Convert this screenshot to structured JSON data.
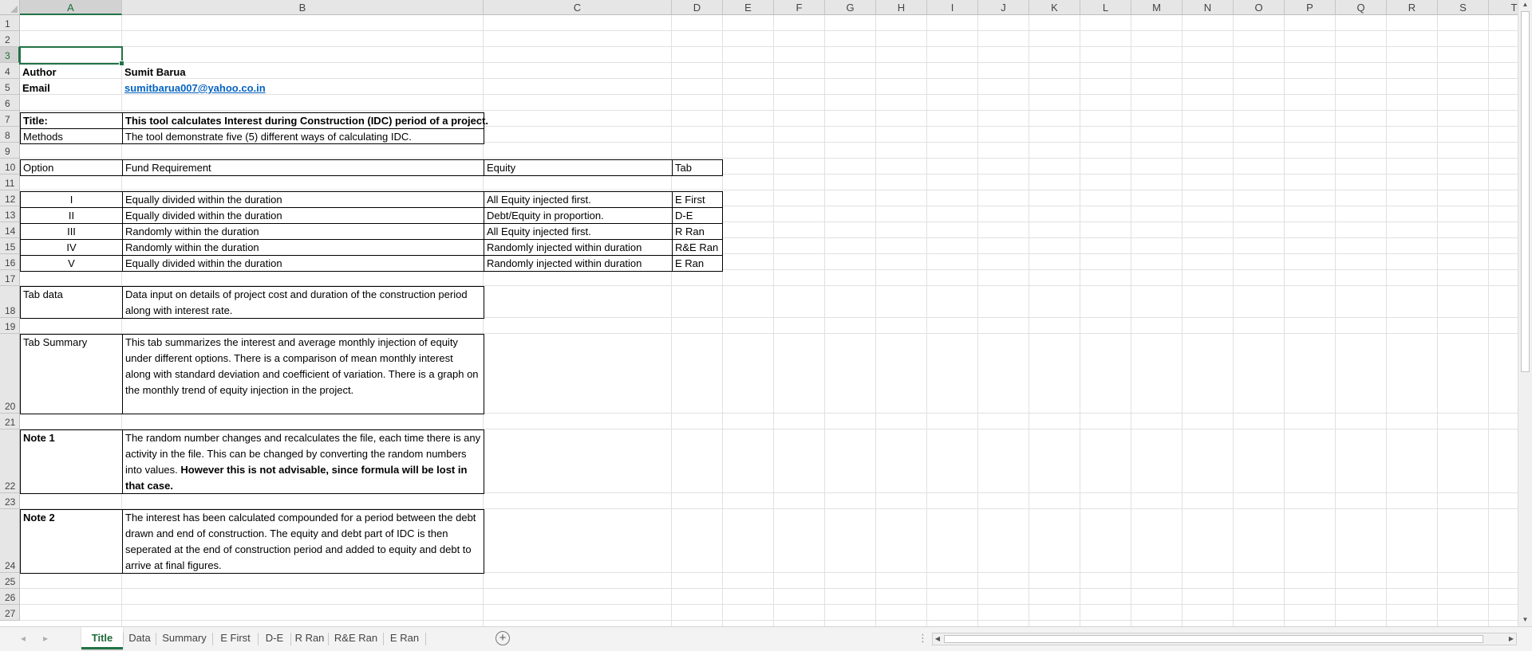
{
  "columns": [
    "A",
    "B",
    "C",
    "D",
    "E",
    "F",
    "G",
    "H",
    "I",
    "J",
    "K",
    "L",
    "M",
    "N",
    "O",
    "P",
    "Q",
    "R",
    "S",
    "T"
  ],
  "rows": [
    "1",
    "2",
    "3",
    "4",
    "5",
    "6",
    "7",
    "8",
    "9",
    "10",
    "11",
    "12",
    "13",
    "14",
    "15",
    "16",
    "17",
    "18",
    "19",
    "20",
    "21",
    "22",
    "23",
    "24",
    "25",
    "26",
    "27"
  ],
  "cells": {
    "author_label": "Author",
    "author_value": "Sumit Barua",
    "email_label": "Email",
    "email_value": "sumitbarua007@yahoo.co.in",
    "title_label": "Title:",
    "title_value": "This tool calculates Interest during Construction (IDC) period of a project.",
    "methods_label": "Methods",
    "methods_value": "The tool demonstrate five (5) different ways of calculating IDC.",
    "hdr_option": "Option",
    "hdr_fund": "Fund Requirement",
    "hdr_equity": "Equity",
    "hdr_tab": "Tab"
  },
  "options": [
    {
      "num": "I",
      "fund": "Equally divided within the duration",
      "equity": "All Equity injected first.",
      "tab": "E First"
    },
    {
      "num": "II",
      "fund": "Equally divided within the duration",
      "equity": "Debt/Equity in proportion.",
      "tab": "D-E"
    },
    {
      "num": "III",
      "fund": "Randomly within the duration",
      "equity": "All Equity injected first.",
      "tab": "R Ran"
    },
    {
      "num": "IV",
      "fund": "Randomly within the duration",
      "equity": "Randomly injected within duration",
      "tab": "R&E Ran"
    },
    {
      "num": "V",
      "fund": "Equally divided within the duration",
      "equity": "Randomly injected within duration",
      "tab": "E Ran"
    }
  ],
  "notes": {
    "tab_data_label": "Tab data",
    "tab_data_text": "Data input on details of project cost and duration of the construction period along with interest rate.",
    "tab_summary_label": "Tab Summary",
    "tab_summary_text": "This tab summarizes the interest and average monthly injection of equity under different options. There is a comparison of mean monthly interest along with standard deviation and coefficient of variation. There is a graph on the monthly trend of equity injection in the project.",
    "note1_label": "Note 1",
    "note1_text": "The random number changes and recalculates the file, each time there is any activity in the file. This can be changed by converting the random numbers into values. ",
    "note1_bold": "However this is not advisable, since formula will be lost in that case.",
    "note2_label": "Note 2",
    "note2_text": "The interest has been calculated compounded for a period between the debt drawn and end of construction. The equity and debt part of IDC is then seperated at the end of construction period and added to equity and debt to arrive at final figures."
  },
  "sheet_tabs": [
    "Title",
    "Data",
    "Summary",
    "E First",
    "D-E",
    "R Ran",
    "R&E Ran",
    "E Ran"
  ],
  "active_tab": "Title",
  "selected_cell": "A3",
  "colors": {
    "accent": "#217346",
    "link": "#0563c1",
    "header_bg": "#e6e6e6",
    "gridline": "#e1e1e1"
  }
}
